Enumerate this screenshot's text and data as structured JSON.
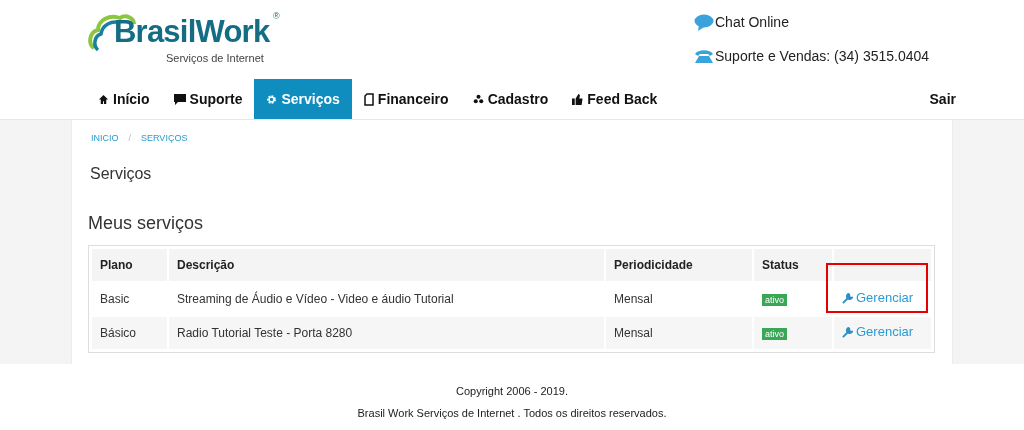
{
  "logo": {
    "name": "BrasilWork",
    "registered": "®",
    "tagline": "Serviços de Internet"
  },
  "contacts": [
    {
      "kind": "chat",
      "label": "Chat Online"
    },
    {
      "kind": "phone",
      "label": "Suporte e Vendas: (34) 3515.0404"
    }
  ],
  "nav": [
    {
      "kind": "home",
      "label": "Início",
      "selected": false
    },
    {
      "kind": "comment",
      "label": "Suporte",
      "selected": false
    },
    {
      "kind": "gear",
      "label": "Serviços",
      "selected": true
    },
    {
      "kind": "document",
      "label": "Financeiro",
      "selected": false
    },
    {
      "kind": "users",
      "label": "Cadastro",
      "selected": false
    },
    {
      "kind": "thumb",
      "label": "Feed Back",
      "selected": false
    }
  ],
  "logout": "Sair",
  "breadcrumb": [
    "INICIO",
    "SERVIÇOS"
  ],
  "breadcrumb_separator": "/",
  "page_title": "Serviços",
  "section_title": "Meus serviços",
  "table": {
    "columns": [
      "Plano",
      "Descrição",
      "Periodicidade",
      "Status"
    ],
    "rows": [
      {
        "plan": "Basic",
        "description": "Streaming de Áudio e Vídeo - Video e áudio Tutorial",
        "period": "Mensal",
        "status": "ativo",
        "action": "Gerenciar",
        "highlighted": true
      },
      {
        "plan": "Básico",
        "description": "Radio Tutorial Teste - Porta 8280",
        "period": "Mensal",
        "status": "ativo",
        "action": "Gerenciar",
        "highlighted": false
      }
    ]
  },
  "footer": [
    "Copyright 2006 - 2019.",
    "Brasil Work Serviços de Internet . Todos os direitos reservados."
  ]
}
